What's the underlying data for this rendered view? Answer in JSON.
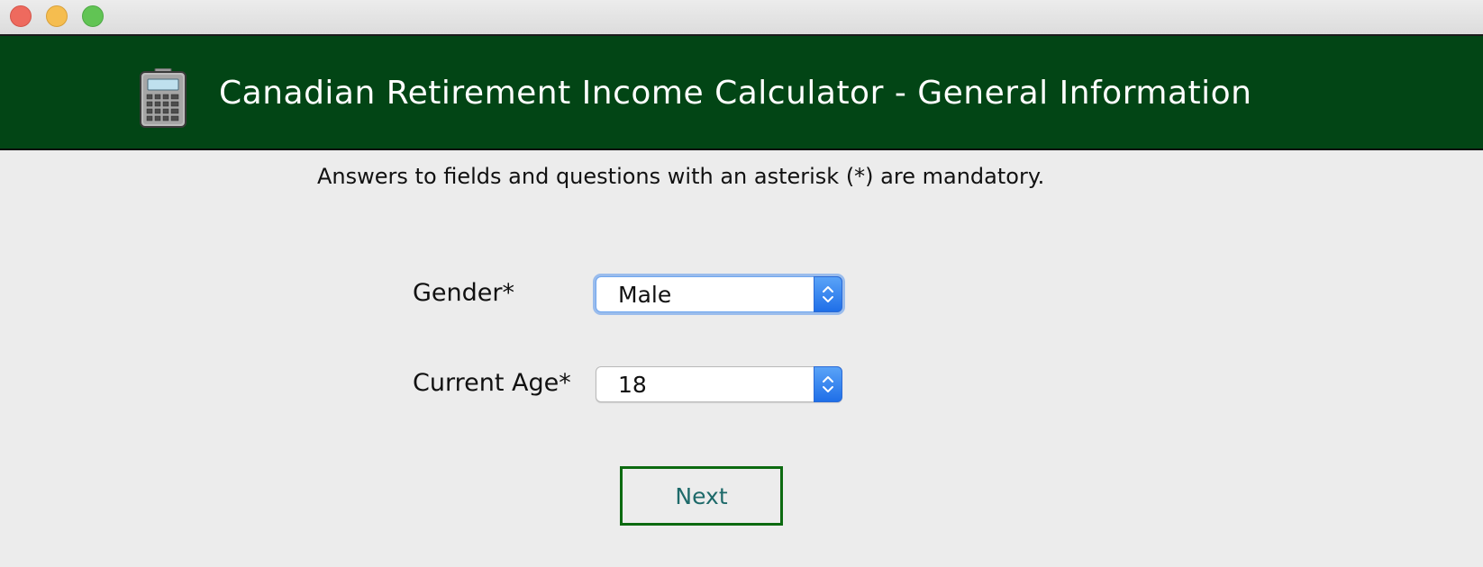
{
  "window": {
    "controls": [
      "close",
      "minimize",
      "maximize"
    ]
  },
  "header": {
    "icon": "calculator-icon",
    "title": "Canadian Retirement Income Calculator - General Information",
    "background_color": "#024515"
  },
  "form": {
    "note": "Answers to fields and questions with an asterisk (*) are mandatory.",
    "gender": {
      "label": "Gender*",
      "value": "Male"
    },
    "age": {
      "label": "Current Age*",
      "value": "18"
    },
    "next_label": "Next"
  },
  "colors": {
    "button_border": "#0c6a10",
    "button_text": "#1e6a6a",
    "select_accent": "#1f6fe8"
  }
}
